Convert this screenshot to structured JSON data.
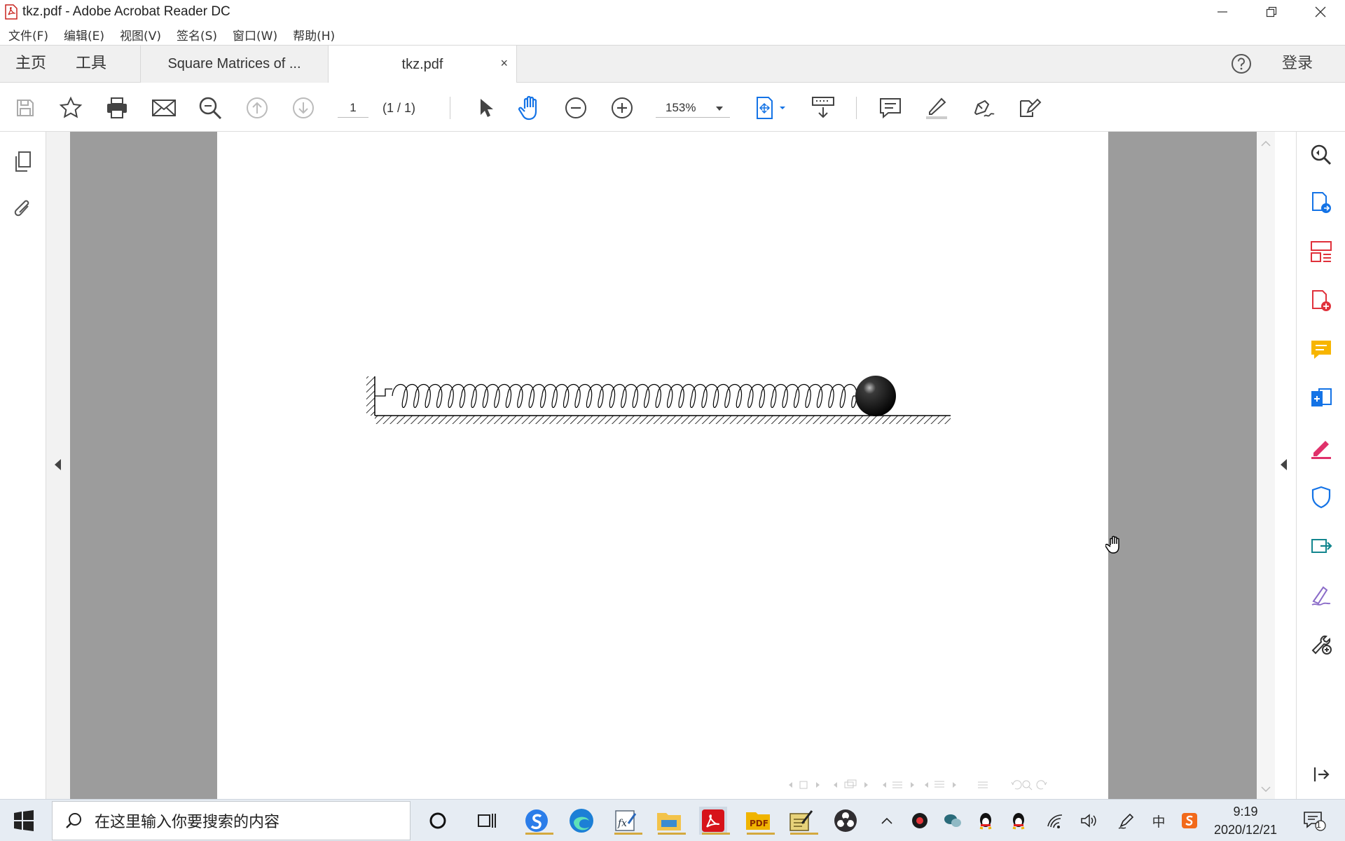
{
  "window": {
    "title": "tkz.pdf - Adobe Acrobat Reader DC"
  },
  "menu": {
    "items": [
      "文件(F)",
      "编辑(E)",
      "视图(V)",
      "签名(S)",
      "窗口(W)",
      "帮助(H)"
    ]
  },
  "tabs": {
    "home": "主页",
    "tools": "工具",
    "documents": [
      {
        "label": "Square Matrices of ...",
        "active": false
      },
      {
        "label": "tkz.pdf",
        "active": true,
        "close": "×"
      }
    ],
    "login": "登录"
  },
  "toolbar": {
    "page_number": "1",
    "page_count": "(1 / 1)",
    "zoom": "153%"
  },
  "taskbar": {
    "search_placeholder": "在这里输入你要搜索的内容",
    "time": "9:19",
    "date": "2020/12/21",
    "notification_count": "1",
    "ime": "中"
  },
  "colors": {
    "accent_blue": "#1473e6",
    "tab_bar": "#f0f0f0",
    "doc_gutter": "#9c9c9c",
    "acrobat_red": "#d7131a"
  }
}
